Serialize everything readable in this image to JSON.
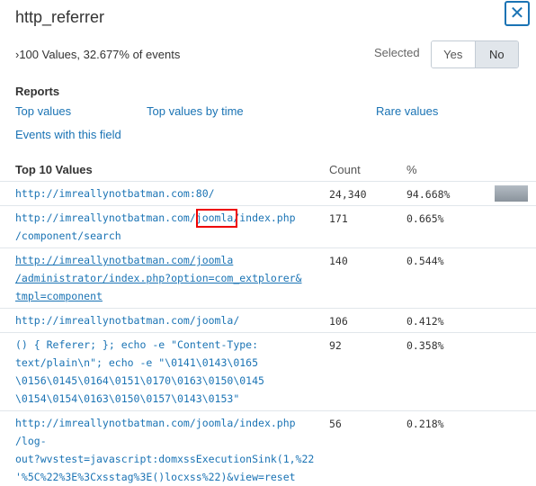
{
  "header": {
    "title": "http_referrer"
  },
  "summary": "›100 Values, 32.677% of events",
  "selected": {
    "label": "Selected",
    "yes": "Yes",
    "no": "No"
  },
  "reports": {
    "heading": "Reports",
    "links": [
      "Top values",
      "Top values by time",
      "Rare values",
      "Events with this field"
    ]
  },
  "table": {
    "headers": [
      "Top 10 Values",
      "Count",
      "%"
    ],
    "rows": [
      {
        "lines": [
          "http://imreallynotbatman.com:80/"
        ],
        "count": "24,340",
        "pct": "94.668%",
        "bar_fraction": 0.94668
      },
      {
        "lines": [
          "http://imreallynotbatman.com/joomla/index.php",
          "/component/search"
        ],
        "count": "171",
        "pct": "0.665%"
      },
      {
        "lines": [
          "http://imreallynotbatman.com/joomla",
          "/administrator/index.php?option=com_extplorer&",
          "tmpl=component"
        ],
        "count": "140",
        "pct": "0.544%"
      },
      {
        "lines": [
          "http://imreallynotbatman.com/joomla/"
        ],
        "count": "106",
        "pct": "0.412%"
      },
      {
        "lines": [
          "() { Referer; }; echo -e \"Content-Type:",
          "text/plain\\n\"; echo -e \"\\0141\\0143\\0165",
          "\\0156\\0145\\0164\\0151\\0170\\0163\\0150\\0145",
          "\\0154\\0154\\0163\\0150\\0157\\0143\\0153\""
        ],
        "count": "92",
        "pct": "0.358%"
      },
      {
        "lines": [
          "http://imreallynotbatman.com/joomla/index.php",
          "/log-",
          "out?wvstest=javascript:domxssExecutionSink(1,%22",
          "'%5C%22%3E%3Cxsstag%3E()locxss%22)&view=reset"
        ],
        "count": "56",
        "pct": "0.218%"
      }
    ]
  }
}
